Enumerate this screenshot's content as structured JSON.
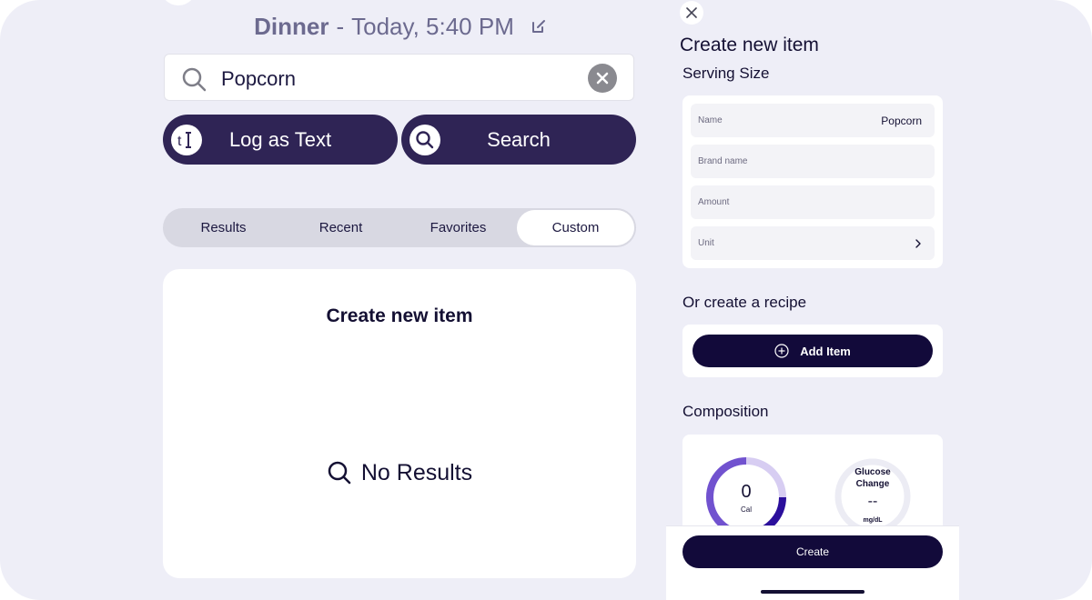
{
  "header": {
    "meal": "Dinner",
    "separator": "-",
    "time": "Today, 5:40 PM"
  },
  "search": {
    "value": "Popcorn",
    "placeholder": ""
  },
  "actions": {
    "log_text": "Log as Text",
    "search": "Search"
  },
  "tabs": [
    {
      "label": "Results",
      "active": false
    },
    {
      "label": "Recent",
      "active": false
    },
    {
      "label": "Favorites",
      "active": false
    },
    {
      "label": "Custom",
      "active": true
    }
  ],
  "card": {
    "title": "Create new item",
    "empty_text": "No Results"
  },
  "panel": {
    "title": "Create new item",
    "serving_size_label": "Serving Size",
    "fields": [
      {
        "label": "Name",
        "value": "Popcorn"
      },
      {
        "label": "Brand name",
        "value": ""
      },
      {
        "label": "Amount",
        "value": ""
      },
      {
        "label": "Unit",
        "value": ""
      }
    ],
    "recipe_label": "Or create a recipe",
    "add_item_label": "Add Item",
    "composition_label": "Composition",
    "calories": {
      "value": "0",
      "unit": "Cal"
    },
    "glucose": {
      "label_line1": "Glucose",
      "label_line2": "Change",
      "value": "--",
      "unit": "mg/dL"
    },
    "create_label": "Create"
  },
  "colors": {
    "background": "#eeeef7",
    "primary_button": "#2f2455",
    "dark_button": "#120a3a",
    "accent_purple": "#6a4cc4",
    "header_text": "#6c6a8f"
  }
}
